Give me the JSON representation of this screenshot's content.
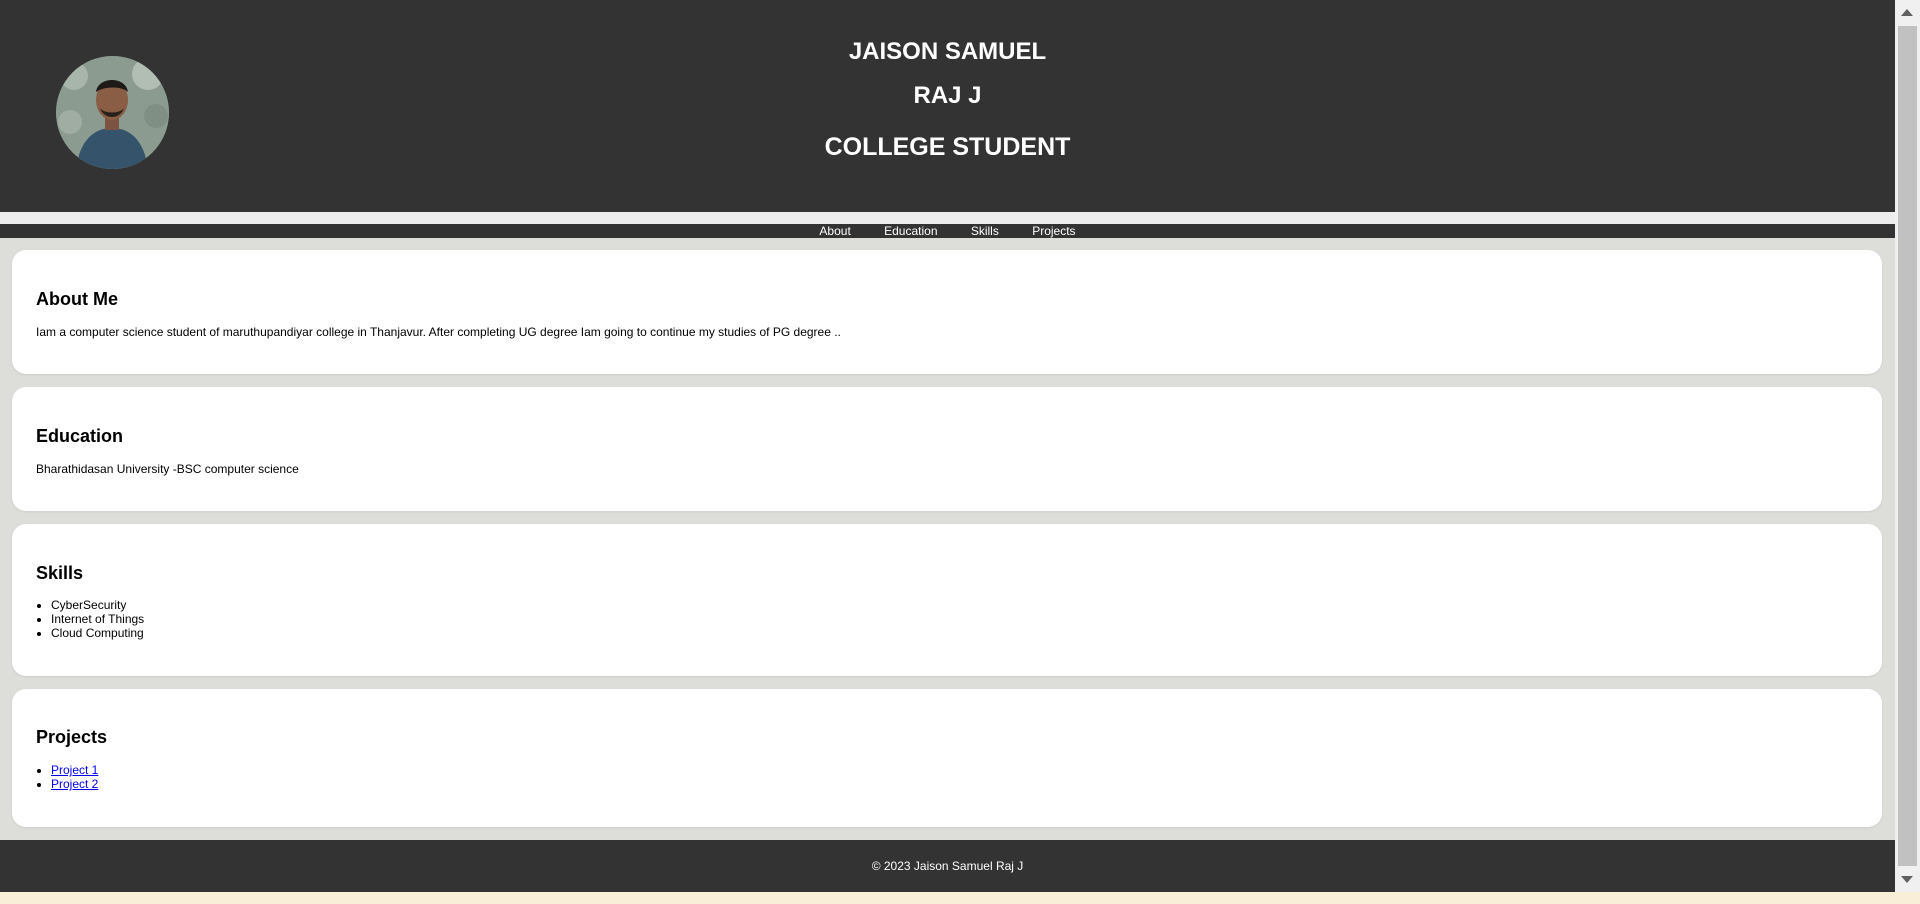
{
  "header": {
    "name_line_1": "JAISON SAMUEL",
    "name_line_2": "RAJ J",
    "role": "COLLEGE STUDENT"
  },
  "nav": {
    "items": [
      "About",
      "Education",
      "Skills",
      "Projects"
    ]
  },
  "about": {
    "title": "About Me",
    "text": "Iam a computer science student of maruthupandiyar college in Thanjavur. After completing UG degree Iam going to continue my studies of PG degree .."
  },
  "education": {
    "title": "Education",
    "text": "Bharathidasan University -BSC computer science"
  },
  "skills": {
    "title": "Skills",
    "items": [
      "CyberSecurity",
      "Internet of Things",
      "Cloud Computing"
    ]
  },
  "projects": {
    "title": "Projects",
    "items": [
      "Project 1",
      "Project 2"
    ]
  },
  "footer": {
    "text": "© 2023 Jaison Samuel Raj J"
  },
  "colors": {
    "header_bg": "#333333",
    "page_bg": "#ddddd9",
    "card_bg": "#ffffff",
    "link": "#0000ee"
  }
}
